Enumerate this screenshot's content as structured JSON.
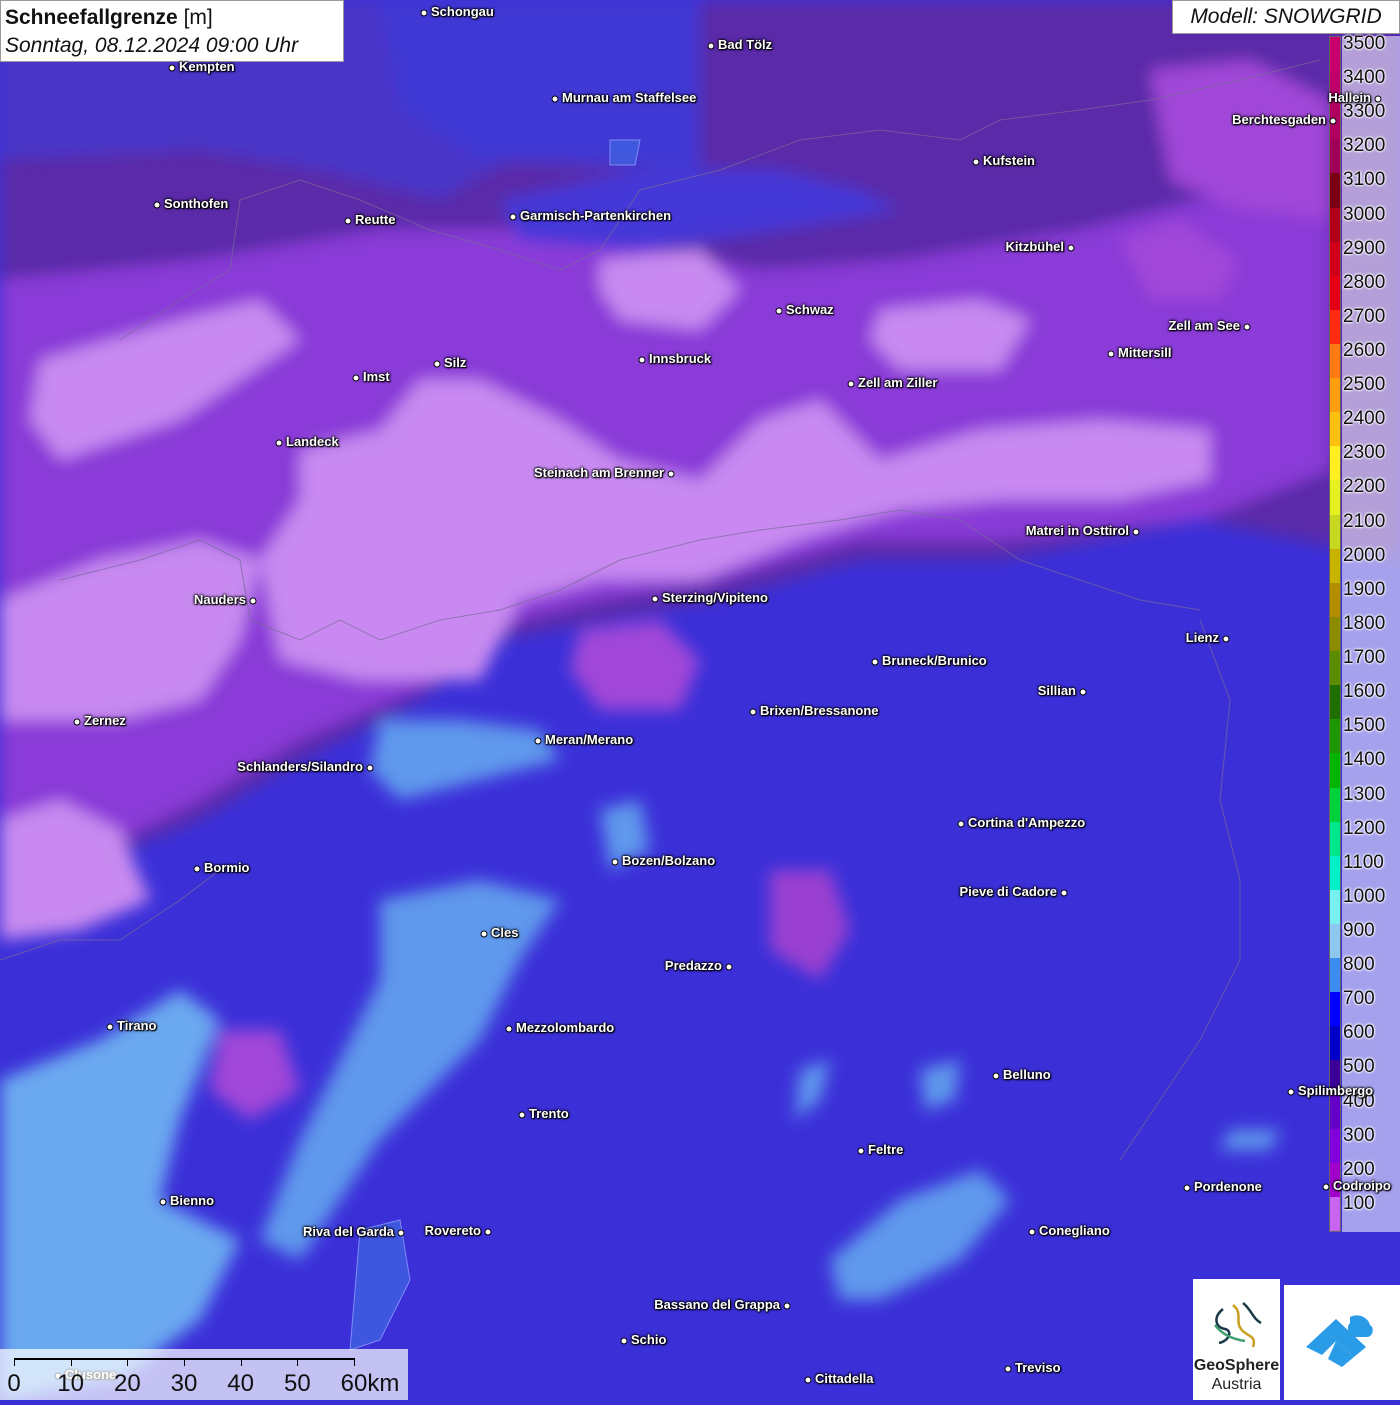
{
  "header": {
    "title_bold": "Schneefallgrenze",
    "title_unit": "[m]",
    "subtitle": "Sonntag, 08.12.2024 09:00 Uhr",
    "model": "Modell: SNOWGRID"
  },
  "legend": {
    "entries": [
      {
        "label": "3500",
        "color": "#c8006e"
      },
      {
        "label": "3400",
        "color": "#c0006a"
      },
      {
        "label": "3300",
        "color": "#b00060"
      },
      {
        "label": "3200",
        "color": "#a00058"
      },
      {
        "label": "3100",
        "color": "#7a0014"
      },
      {
        "label": "3000",
        "color": "#b0001a"
      },
      {
        "label": "2900",
        "color": "#d00018"
      },
      {
        "label": "2800",
        "color": "#e60016"
      },
      {
        "label": "2700",
        "color": "#ff2a10"
      },
      {
        "label": "2600",
        "color": "#ff7a10"
      },
      {
        "label": "2500",
        "color": "#ff9c10"
      },
      {
        "label": "2400",
        "color": "#ffc010"
      },
      {
        "label": "2300",
        "color": "#ffee20"
      },
      {
        "label": "2200",
        "color": "#e6f020"
      },
      {
        "label": "2100",
        "color": "#c8d820"
      },
      {
        "label": "2000",
        "color": "#c8b400"
      },
      {
        "label": "1900",
        "color": "#b48c00"
      },
      {
        "label": "1800",
        "color": "#8c8c00"
      },
      {
        "label": "1700",
        "color": "#5a8c00"
      },
      {
        "label": "1600",
        "color": "#1e6e00"
      },
      {
        "label": "1500",
        "color": "#1e9600"
      },
      {
        "label": "1400",
        "color": "#00b400"
      },
      {
        "label": "1300",
        "color": "#00d23c"
      },
      {
        "label": "1200",
        "color": "#00e68c"
      },
      {
        "label": "1100",
        "color": "#00f0c8"
      },
      {
        "label": "1000",
        "color": "#78f0f0"
      },
      {
        "label": "900",
        "color": "#8cc8f0"
      },
      {
        "label": "800",
        "color": "#3c8cf0"
      },
      {
        "label": "700",
        "color": "#0000ff"
      },
      {
        "label": "600",
        "color": "#0000c8"
      },
      {
        "label": "500",
        "color": "#3c0096"
      },
      {
        "label": "400",
        "color": "#6400c8"
      },
      {
        "label": "300",
        "color": "#8200dc"
      },
      {
        "label": "200",
        "color": "#a000c8"
      },
      {
        "label": "100",
        "color": "#c864f0"
      }
    ]
  },
  "cities": [
    {
      "name": "Schongau"
    },
    {
      "name": "Bad Tölz"
    },
    {
      "name": "Kempten"
    },
    {
      "name": "Murnau am Staffelsee"
    },
    {
      "name": "Hallein"
    },
    {
      "name": "Berchtesgaden"
    },
    {
      "name": "Kufstein"
    },
    {
      "name": "Sonthofen"
    },
    {
      "name": "Reutte"
    },
    {
      "name": "Garmisch-Partenkirchen"
    },
    {
      "name": "Kitzbühel"
    },
    {
      "name": "Schwaz"
    },
    {
      "name": "Zell am See"
    },
    {
      "name": "Innsbruck"
    },
    {
      "name": "Mittersill"
    },
    {
      "name": "Silz"
    },
    {
      "name": "Imst"
    },
    {
      "name": "Zell am Ziller"
    },
    {
      "name": "Landeck"
    },
    {
      "name": "Steinach am Brenner"
    },
    {
      "name": "Matrei in Osttirol"
    },
    {
      "name": "Nauders"
    },
    {
      "name": "Sterzing/Vipiteno"
    },
    {
      "name": "Lienz"
    },
    {
      "name": "Bruneck/Brunico"
    },
    {
      "name": "Sillian"
    },
    {
      "name": "Brixen/Bressanone"
    },
    {
      "name": "Zernez"
    },
    {
      "name": "Meran/Merano"
    },
    {
      "name": "Schlanders/Silandro"
    },
    {
      "name": "Cortina d'Ampezzo"
    },
    {
      "name": "Bozen/Bolzano"
    },
    {
      "name": "Bormio"
    },
    {
      "name": "Pieve di Cadore"
    },
    {
      "name": "Cles"
    },
    {
      "name": "Predazzo"
    },
    {
      "name": "Tirano"
    },
    {
      "name": "Mezzolombardo"
    },
    {
      "name": "Belluno"
    },
    {
      "name": "Spilimbergo"
    },
    {
      "name": "Trento"
    },
    {
      "name": "Feltre"
    },
    {
      "name": "Pordenone"
    },
    {
      "name": "Bienno"
    },
    {
      "name": "Riva del Garda"
    },
    {
      "name": "Rovereto"
    },
    {
      "name": "Conegliano"
    },
    {
      "name": "Bassano del Grappa"
    },
    {
      "name": "Schio"
    },
    {
      "name": "Treviso"
    },
    {
      "name": "Cittadella"
    },
    {
      "name": "Codroipo"
    },
    {
      "name": "Clusone"
    }
  ],
  "scale_bar": {
    "labels": [
      "0",
      "10",
      "20",
      "30",
      "40",
      "50",
      "60km"
    ]
  },
  "logos": {
    "geosphere_line1": "GeoSphere",
    "geosphere_line2": "Austria"
  }
}
